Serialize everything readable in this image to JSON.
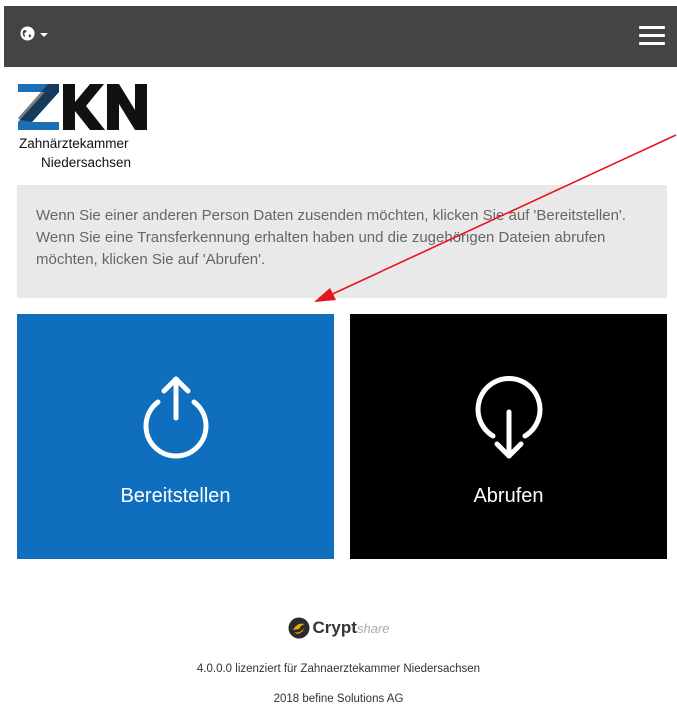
{
  "header": {
    "language_icon": "globe-icon",
    "menu_icon": "hamburger-menu-icon"
  },
  "logo": {
    "mark": "ZKN",
    "line1": "Zahnärztekammer",
    "line2": "Niedersachsen",
    "colors": {
      "blue": "#1a6fb7",
      "dark": "#111111"
    }
  },
  "info": {
    "text": "Wenn Sie einer anderen Person Daten zusenden möchten, klicken Sie auf 'Bereitstellen'. Wenn Sie eine Transferkennung erhalten haben und die zugehörigen Dateien abrufen möchten, klicken Sie auf 'Abrufen'."
  },
  "tiles": [
    {
      "label": "Bereitstellen",
      "icon": "upload-icon",
      "color": "#0f6ebd"
    },
    {
      "label": "Abrufen",
      "icon": "download-icon",
      "color": "#000000"
    }
  ],
  "footer": {
    "brand_bold": "Crypt",
    "brand_light": "share",
    "license": "4.0.0.0 lizenziert für Zahnaerztekammer Niedersachsen",
    "copyright": "2018 befine Solutions AG"
  },
  "annotation": {
    "arrow_color": "#e8141c"
  }
}
